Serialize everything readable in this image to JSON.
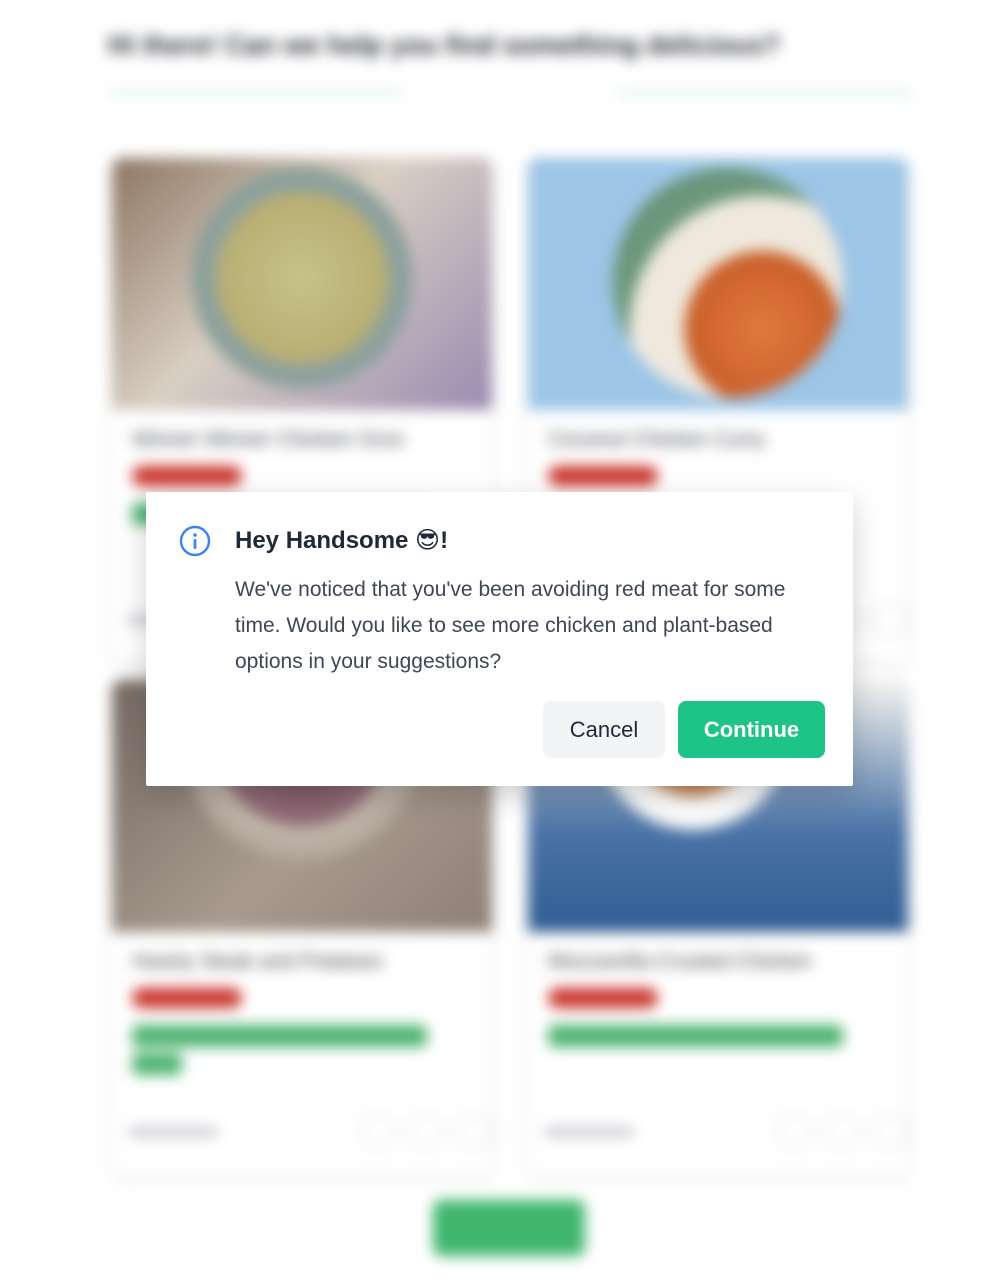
{
  "background": {
    "heading": "Hi there! Can we help you find something delicious?",
    "divider_label": "",
    "cards": [
      {
        "title": "Winner Winner Chicken Orzo"
      },
      {
        "title": "Coconut Chicken Curry"
      },
      {
        "title": "Hearty Steak and Potatoes"
      },
      {
        "title": "Mozzarella-Crusted Chicken"
      }
    ],
    "load_more_label": ""
  },
  "dialog": {
    "icon": "info-circle-icon",
    "title": "Hey Handsome 😎!",
    "message": "We've noticed that you've been avoiding red meat for some time. Would you like to see more chicken and plant-based options in your suggestions?",
    "cancel_label": "Cancel",
    "continue_label": "Continue"
  },
  "colors": {
    "accent": "#1ec487",
    "info": "#3b82f6",
    "cancel_bg": "#f3f4f6"
  }
}
